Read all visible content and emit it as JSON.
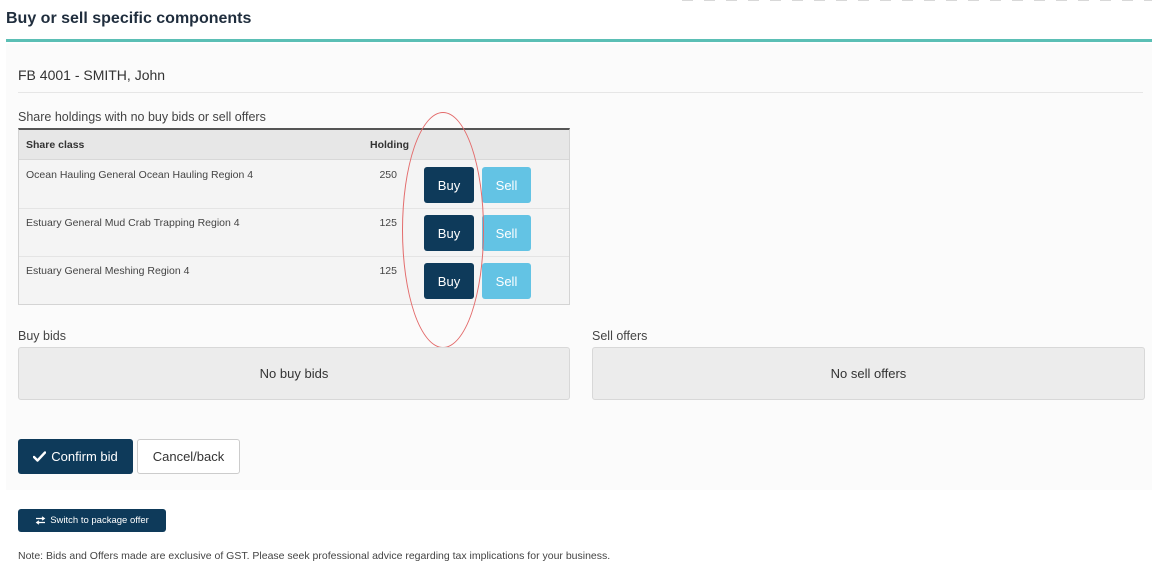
{
  "page": {
    "title": "Buy or sell specific components"
  },
  "member": {
    "name": "FB 4001 - SMITH, John"
  },
  "holdings": {
    "label": "Share holdings with no buy bids or sell offers",
    "columns": {
      "share_class": "Share class",
      "holding": "Holding"
    },
    "rows": [
      {
        "share_class": "Ocean Hauling General Ocean Hauling Region 4",
        "holding": "250",
        "buy_label": "Buy",
        "sell_label": "Sell"
      },
      {
        "share_class": "Estuary General Mud Crab Trapping Region 4",
        "holding": "125",
        "buy_label": "Buy",
        "sell_label": "Sell"
      },
      {
        "share_class": "Estuary General Meshing Region 4",
        "holding": "125",
        "buy_label": "Buy",
        "sell_label": "Sell"
      }
    ]
  },
  "buy_bids": {
    "label": "Buy bids",
    "empty_text": "No buy bids"
  },
  "sell_offers": {
    "label": "Sell offers",
    "empty_text": "No sell offers"
  },
  "actions": {
    "confirm_label": "Confirm bid",
    "cancel_label": "Cancel/back",
    "switch_label": "Switch to package offer"
  },
  "note": "Note: Bids and Offers made are exclusive of GST. Please seek professional advice regarding tax implications for your business.",
  "colors": {
    "primary": "#0e3a5a",
    "sell_button": "#63c3e4",
    "title_rule": "#5bbfb5",
    "annotation": "#e36b6b"
  },
  "icons": {
    "confirm": "checkmark-icon",
    "switch": "exchange-arrows-icon"
  }
}
